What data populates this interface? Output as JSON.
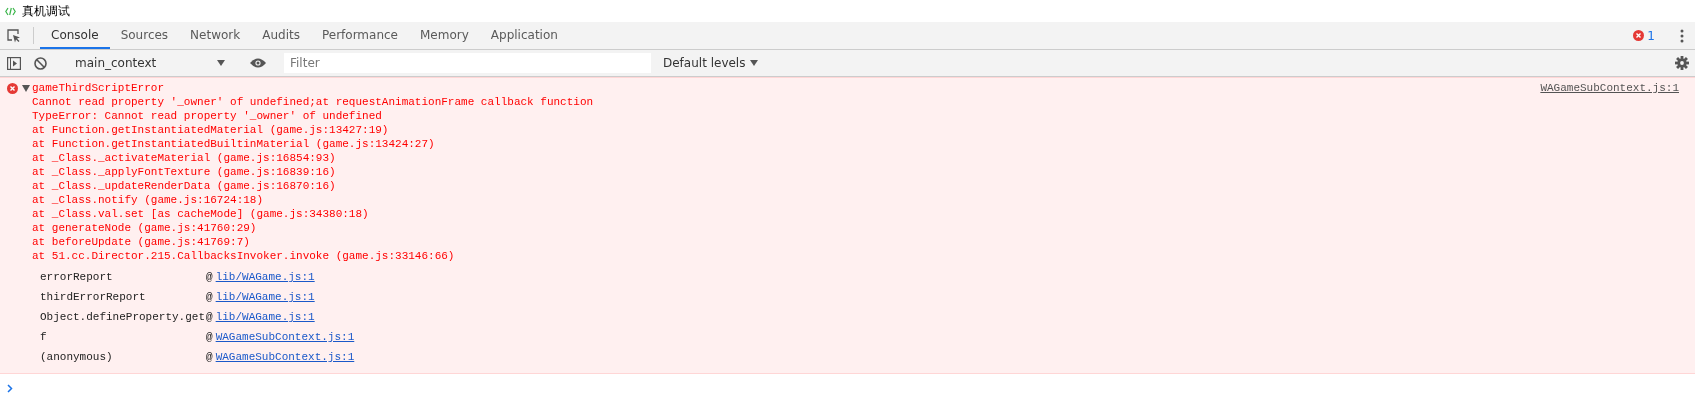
{
  "window": {
    "title": "真机调试"
  },
  "tabs": [
    {
      "label": "Console",
      "selected": true
    },
    {
      "label": "Sources",
      "selected": false
    },
    {
      "label": "Network",
      "selected": false
    },
    {
      "label": "Audits",
      "selected": false
    },
    {
      "label": "Performance",
      "selected": false
    },
    {
      "label": "Memory",
      "selected": false
    },
    {
      "label": "Application",
      "selected": false
    }
  ],
  "error_count": "1",
  "toolbar": {
    "context": "main_context",
    "filter": {
      "placeholder": "Filter"
    },
    "levels": "Default levels"
  },
  "messages": [
    {
      "kind": "error",
      "expanded": true,
      "title": "gameThirdScriptError",
      "source": "WAGameSubContext.js:1",
      "lines": [
        "Cannot read property '_owner' of undefined;at requestAnimationFrame callback function",
        "TypeError: Cannot read property '_owner' of undefined",
        "at Function.getInstantiatedMaterial (game.js:13427:19)",
        "at Function.getInstantiatedBuiltinMaterial (game.js:13424:27)",
        "at _Class._activateMaterial (game.js:16854:93)",
        "at _Class._applyFontTexture (game.js:16839:16)",
        "at _Class._updateRenderData (game.js:16870:16)",
        "at _Class.notify (game.js:16724:18)",
        "at _Class.val.set [as cacheMode] (game.js:34380:18)",
        "at generateNode (game.js:41760:29)",
        "at beforeUpdate (game.js:41769:7)",
        "at 51.cc.Director.215.CallbacksInvoker.invoke (game.js:33146:66)"
      ],
      "stack": [
        {
          "function": "errorReport",
          "at": "@",
          "link": "lib/WAGame.js:1"
        },
        {
          "function": "thirdErrorReport",
          "at": "@",
          "link": "lib/WAGame.js:1"
        },
        {
          "function": "Object.defineProperty.get",
          "at": "@",
          "link": "lib/WAGame.js:1"
        },
        {
          "function": "f",
          "at": "@",
          "link": "WAGameSubContext.js:1"
        },
        {
          "function": "(anonymous)",
          "at": "@",
          "link": "WAGameSubContext.js:1"
        }
      ]
    }
  ]
}
